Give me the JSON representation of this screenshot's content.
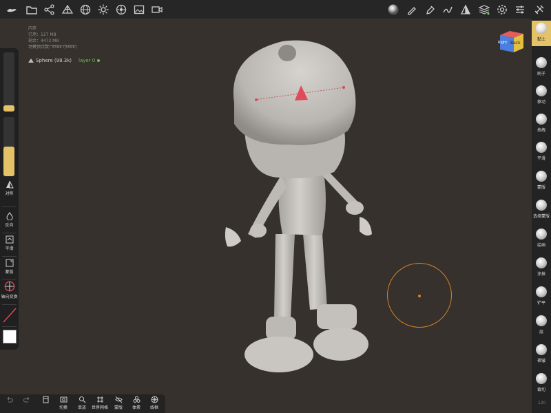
{
  "stats": {
    "title": "内存",
    "used": "已用：127 MB",
    "free": "剩余：4472 MB",
    "vertices": "场景顶点数: 358k (389k)"
  },
  "scene": {
    "mesh_name": "Sphere (98.3k)",
    "layer": "layer 0"
  },
  "gizmo": {
    "right": "Right",
    "back": "Back"
  },
  "fps": "120",
  "left_tools": [
    {
      "label": "对称",
      "icon": "symmetry-icon"
    },
    {
      "label": "反向",
      "icon": "invert-icon"
    },
    {
      "label": "平滑",
      "icon": "smooth-icon"
    },
    {
      "label": "蒙版",
      "icon": "mask-icon"
    },
    {
      "label": "轴向变换",
      "icon": "transform-gizmo-icon"
    }
  ],
  "sliders": {
    "radius": 0.1,
    "intensity": 0.5
  },
  "right_tools": [
    {
      "label": "黏土",
      "active": true
    },
    {
      "label": "刷子"
    },
    {
      "label": "移动"
    },
    {
      "label": "拖拽"
    },
    {
      "label": "平滑"
    },
    {
      "label": "蒙版"
    },
    {
      "label": "选择蒙版"
    },
    {
      "label": "绘画"
    },
    {
      "label": "涂抹"
    },
    {
      "label": "铲平"
    },
    {
      "label": "层"
    },
    {
      "label": "褶皱"
    },
    {
      "label": "裁切"
    }
  ],
  "bottom_tools": [
    {
      "label": "",
      "icon": "undo-icon"
    },
    {
      "label": "",
      "icon": "redo-icon"
    },
    {
      "label": "",
      "icon": "camera-view-icon"
    },
    {
      "label": "切换",
      "icon": "switch-icon"
    },
    {
      "label": "单放",
      "icon": "isolate-icon"
    },
    {
      "label": "世界网格",
      "icon": "grid-icon"
    },
    {
      "label": "蒙版",
      "icon": "hide-icon"
    },
    {
      "label": "体素",
      "icon": "voxel-icon"
    },
    {
      "label": "线框",
      "icon": "wireframe-icon"
    }
  ],
  "top_icons": [
    "logo-icon",
    "folder-icon",
    "scene-graph-icon",
    "topology-icon",
    "sphere-material-icon",
    "light-icon",
    "render-icon",
    "image-icon",
    "video-icon",
    "matcap-icon",
    "brush-icon",
    "pen-icon",
    "stroke-icon",
    "triangle-icon",
    "layers-icon",
    "settings-icon",
    "sliders-icon",
    "tools-icon"
  ],
  "colors": {
    "accent": "#e4c267",
    "brush_ring": "#d68127",
    "background": "#36312d",
    "layer_green": "#6bbf4a"
  }
}
